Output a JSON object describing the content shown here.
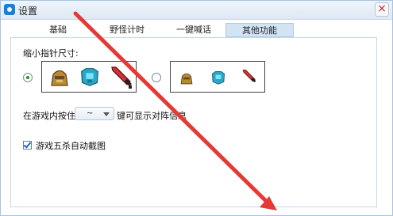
{
  "window": {
    "title": "设置",
    "close_glyph": "×"
  },
  "tabs": [
    {
      "label": "基础"
    },
    {
      "label": "野怪计时"
    },
    {
      "label": "一键喊话"
    },
    {
      "label": "其他功能",
      "active": true
    }
  ],
  "cursor_size": {
    "label": "缩小指针尺寸:",
    "large_selected": true,
    "icons": [
      "helmet-icon",
      "armor-icon",
      "sword-icon"
    ]
  },
  "hotkey": {
    "prefix": "在游戏内按住",
    "value": "~",
    "suffix": "键可显示对阵信息"
  },
  "screenshot_option": {
    "label": "游戏五杀自动截图",
    "checked": true
  },
  "colors": {
    "accent": "#2c8f1e",
    "annotation_arrow": "#e53935"
  }
}
